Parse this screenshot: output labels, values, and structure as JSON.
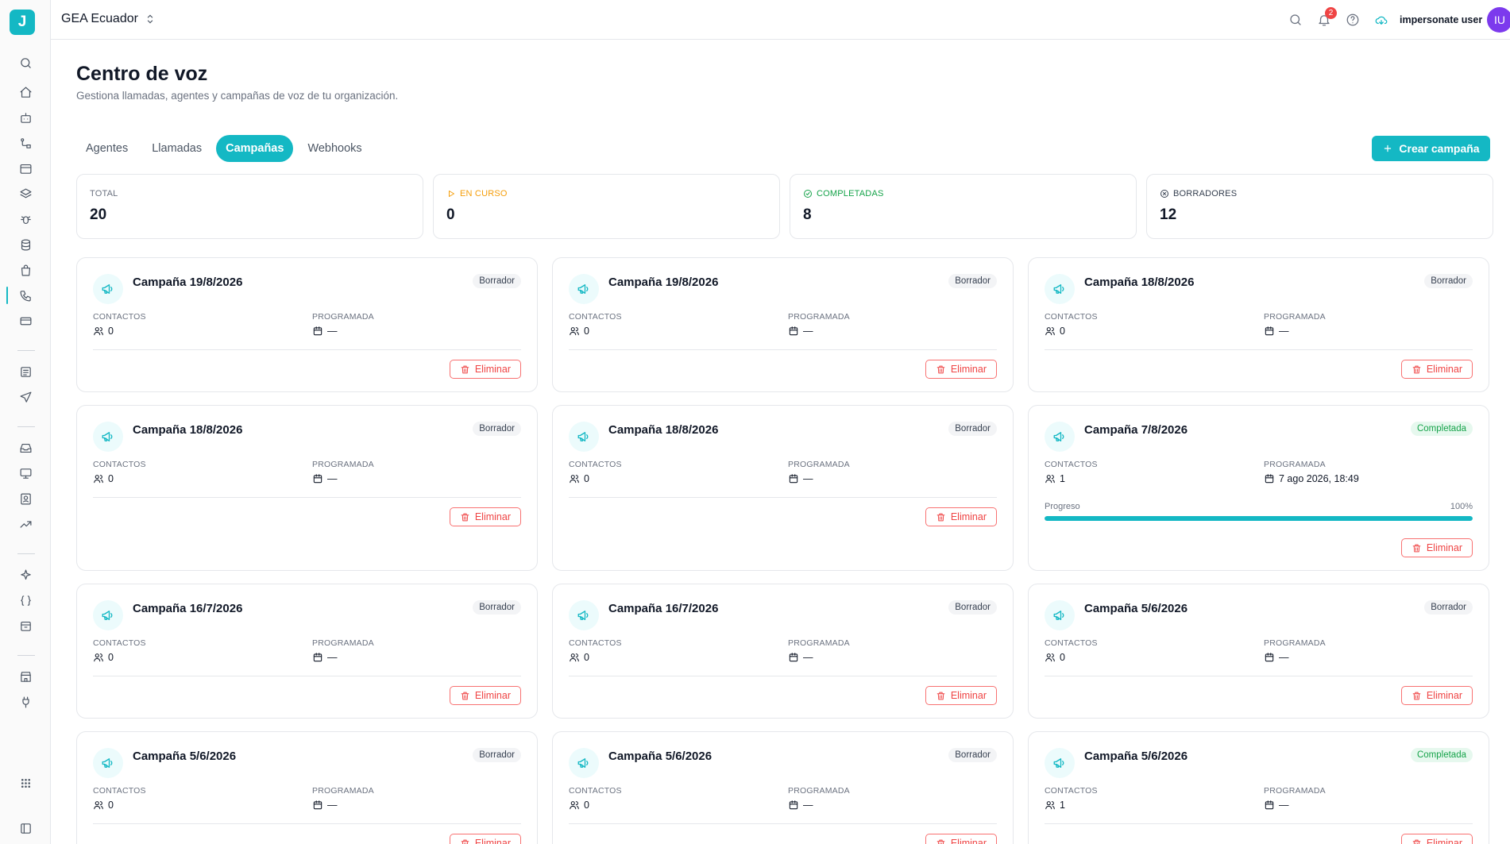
{
  "header": {
    "org_name": "GEA Ecuador",
    "notifications_count": "2",
    "user_name": "impersonate user",
    "avatar_initials": "IU"
  },
  "page": {
    "title": "Centro de voz",
    "subtitle": "Gestiona llamadas, agentes y campañas de voz de tu organización."
  },
  "tabs": [
    {
      "label": "Agentes",
      "active": false
    },
    {
      "label": "Llamadas",
      "active": false
    },
    {
      "label": "Campañas",
      "active": true
    },
    {
      "label": "Webhooks",
      "active": false
    }
  ],
  "create_button_label": "Crear campaña",
  "stats": [
    {
      "label": "TOTAL",
      "value": "20",
      "icon": "",
      "color": "#6b7280"
    },
    {
      "label": "EN CURSO",
      "value": "0",
      "icon": "play-icon",
      "color": "#f59e0b"
    },
    {
      "label": "COMPLETADAS",
      "value": "8",
      "icon": "check-circle-icon",
      "color": "#16a34a"
    },
    {
      "label": "BORRADORES",
      "value": "12",
      "icon": "x-circle-icon",
      "color": "#374151"
    }
  ],
  "labels": {
    "contacts": "CONTACTOS",
    "scheduled": "PROGRAMADA",
    "progress": "Progreso",
    "delete": "Eliminar"
  },
  "campaigns": [
    {
      "title": "Campaña 19/8/2026",
      "status": "Borrador",
      "contacts": "0",
      "scheduled": "—"
    },
    {
      "title": "Campaña 19/8/2026",
      "status": "Borrador",
      "contacts": "0",
      "scheduled": "—"
    },
    {
      "title": "Campaña 18/8/2026",
      "status": "Borrador",
      "contacts": "0",
      "scheduled": "—"
    },
    {
      "title": "Campaña 18/8/2026",
      "status": "Borrador",
      "contacts": "0",
      "scheduled": "—"
    },
    {
      "title": "Campaña 18/8/2026",
      "status": "Borrador",
      "contacts": "0",
      "scheduled": "—"
    },
    {
      "title": "Campaña 7/8/2026",
      "status": "Completada",
      "contacts": "1",
      "scheduled": "7 ago 2026, 18:49",
      "progress": 100,
      "progress_text": "100%"
    },
    {
      "title": "Campaña 16/7/2026",
      "status": "Borrador",
      "contacts": "0",
      "scheduled": "—"
    },
    {
      "title": "Campaña 16/7/2026",
      "status": "Borrador",
      "contacts": "0",
      "scheduled": "—"
    },
    {
      "title": "Campaña 5/6/2026",
      "status": "Borrador",
      "contacts": "0",
      "scheduled": "—"
    },
    {
      "title": "Campaña 5/6/2026",
      "status": "Borrador",
      "contacts": "0",
      "scheduled": "—"
    },
    {
      "title": "Campaña 5/6/2026",
      "status": "Borrador",
      "contacts": "0",
      "scheduled": "—"
    },
    {
      "title": "Campaña 5/6/2026",
      "status": "Completada",
      "contacts": "1",
      "scheduled": "—"
    }
  ],
  "colors": {
    "accent": "#14b8c4",
    "danger": "#ef4444",
    "success": "#16a34a",
    "avatar": "#7c3aed"
  },
  "sidebar": {
    "icons": [
      "search-icon",
      "home-icon",
      "bot-icon",
      "workflow-icon",
      "archive-icon",
      "layers-icon",
      "bug-icon",
      "database-icon",
      "bag-icon",
      "phone-icon",
      "card-icon",
      "list-icon",
      "send-icon",
      "inbox-icon",
      "monitor-icon",
      "contact-icon",
      "trending-icon",
      "sparkle-icon",
      "braces-icon",
      "package-icon",
      "store-icon",
      "plug-icon",
      "grid-icon",
      "panel-icon"
    ]
  }
}
